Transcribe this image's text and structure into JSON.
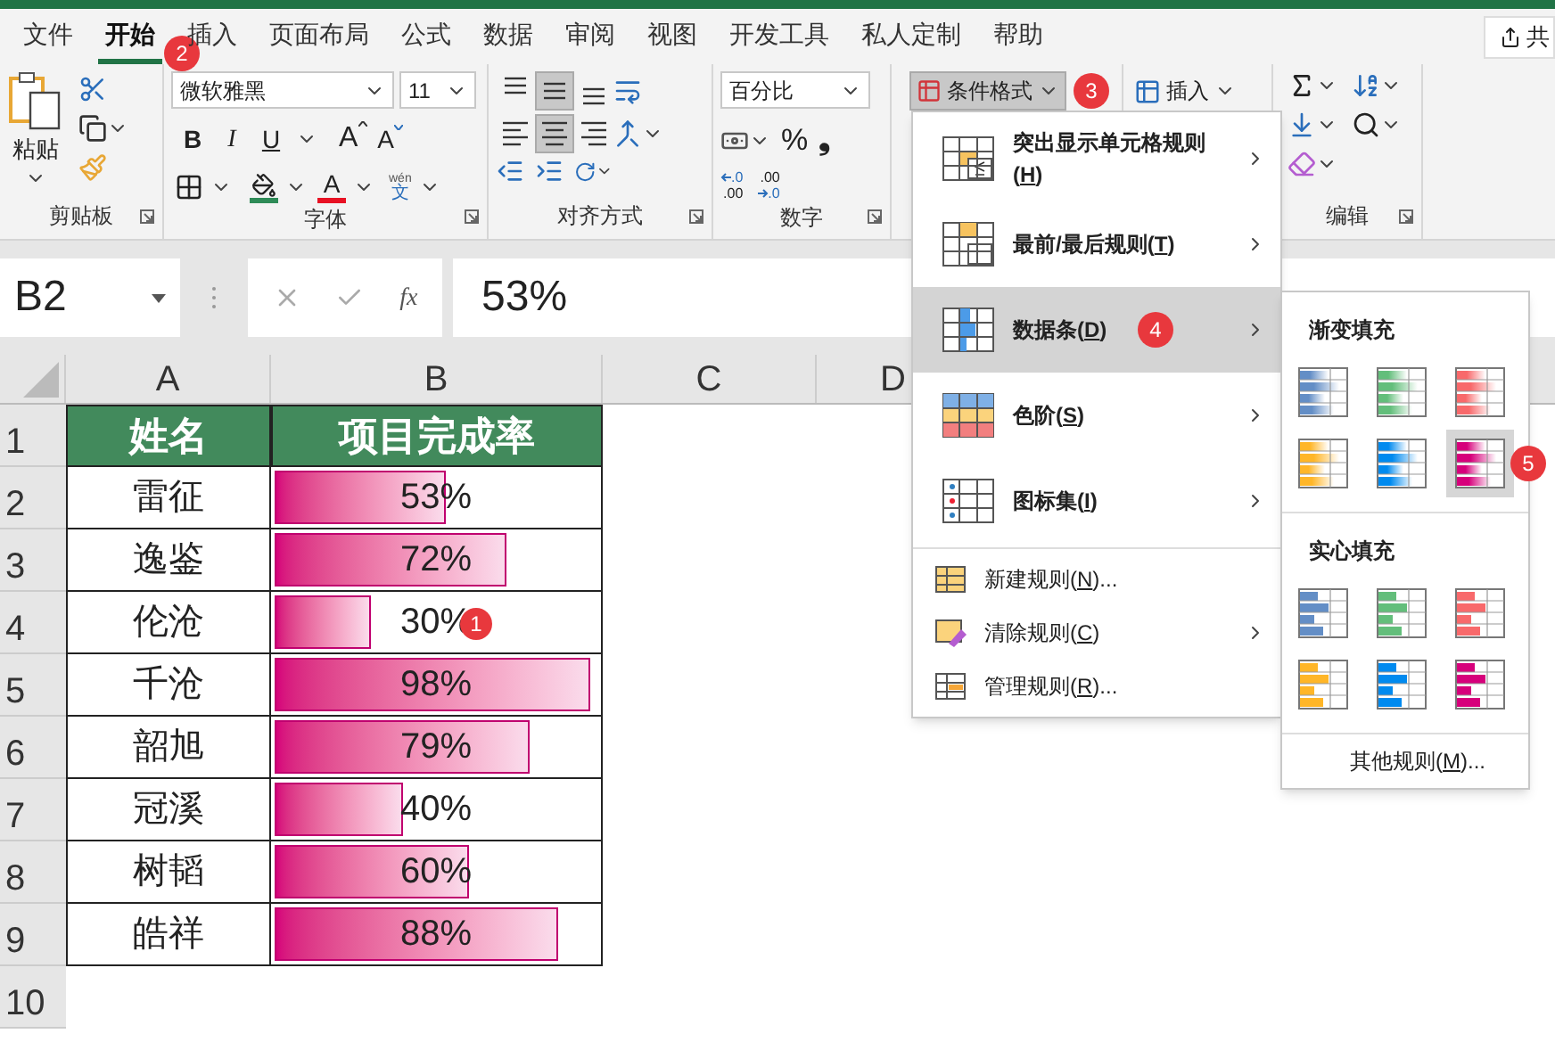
{
  "tabs": [
    {
      "label": "文件",
      "selected": false
    },
    {
      "label": "开始",
      "selected": true,
      "badge": "2"
    },
    {
      "label": "插入",
      "selected": false
    },
    {
      "label": "页面布局",
      "selected": false
    },
    {
      "label": "公式",
      "selected": false
    },
    {
      "label": "数据",
      "selected": false
    },
    {
      "label": "审阅",
      "selected": false
    },
    {
      "label": "视图",
      "selected": false
    },
    {
      "label": "开发工具",
      "selected": false
    },
    {
      "label": "私人定制",
      "selected": false
    },
    {
      "label": "帮助",
      "selected": false
    }
  ],
  "share_button": "共",
  "ribbon": {
    "clipboard": {
      "paste": "粘贴",
      "label": "剪贴板"
    },
    "font": {
      "name": "微软雅黑",
      "size": "11",
      "bold": "B",
      "italic": "I",
      "underline": "U",
      "grow": "A",
      "shrink": "A",
      "font_color": "A",
      "phonetic_top": "wén",
      "phonetic_bottom": "文",
      "label": "字体"
    },
    "alignment": {
      "buttons": [
        {
          "kind": "top",
          "selected": false
        },
        {
          "kind": "middle",
          "selected": true
        },
        {
          "kind": "bottom",
          "selected": false
        },
        {
          "kind": "left",
          "selected": false
        },
        {
          "kind": "center",
          "selected": true
        },
        {
          "kind": "right",
          "selected": false
        }
      ],
      "label": "对齐方式"
    },
    "number": {
      "format": "百分比",
      "percent": "%",
      "comma": "❟",
      "increase_decimal": [
        ".0",
        ".00"
      ],
      "decrease_decimal": [
        ".00",
        ".0"
      ],
      "label": "数字"
    },
    "styles": {
      "conditional_format": "条件格式",
      "badge": "3"
    },
    "cells": {
      "insert": "插入"
    },
    "editing": {
      "label": "编辑"
    }
  },
  "formula_bar": {
    "name_box": "B2",
    "fx": "fx",
    "formula": "53%"
  },
  "sheet": {
    "columns": [
      "A",
      "B",
      "C",
      "D"
    ],
    "row_numbers": [
      "1",
      "2",
      "3",
      "4",
      "5",
      "6",
      "7",
      "8",
      "9",
      "10"
    ],
    "header": [
      "姓名",
      "项目完成率"
    ],
    "rows": [
      {
        "name": "雷征",
        "value": "53%",
        "level": 0.53
      },
      {
        "name": "逸鉴",
        "value": "72%",
        "level": 0.72
      },
      {
        "name": "伦沧",
        "value": "30%",
        "level": 0.3,
        "badge": "1"
      },
      {
        "name": "千沧",
        "value": "98%",
        "level": 0.98
      },
      {
        "name": "韶旭",
        "value": "79%",
        "level": 0.79
      },
      {
        "name": "冠溪",
        "value": "40%",
        "level": 0.4
      },
      {
        "name": "树韬",
        "value": "60%",
        "level": 0.6
      },
      {
        "name": "皓祥",
        "value": "88%",
        "level": 0.88
      }
    ]
  },
  "menu": {
    "items": [
      {
        "kind": "highlight",
        "label": "突出显示单元格规则(",
        "key": "H",
        "tail": ")",
        "submenu": true,
        "selected": false
      },
      {
        "kind": "topbottom",
        "label": "最前/最后规则(",
        "key": "T",
        "tail": ")",
        "submenu": true,
        "selected": false
      },
      {
        "kind": "databar",
        "label": "数据条(",
        "key": "D",
        "tail": ")",
        "submenu": true,
        "selected": true,
        "badge": "4"
      },
      {
        "kind": "colorscale",
        "label": "色阶(",
        "key": "S",
        "tail": ")",
        "submenu": true,
        "selected": false
      },
      {
        "kind": "iconset",
        "label": "图标集(",
        "key": "I",
        "tail": ")",
        "submenu": true,
        "selected": false
      },
      {
        "kind": "new",
        "label": "新建规则(",
        "key": "N",
        "tail": ")...",
        "submenu": false,
        "selected": false
      },
      {
        "kind": "clear",
        "label": "清除规则(",
        "key": "C",
        "tail": ")",
        "submenu": true,
        "selected": false
      },
      {
        "kind": "manage",
        "label": "管理规则(",
        "key": "R",
        "tail": ")...",
        "submenu": false,
        "selected": false
      }
    ]
  },
  "submenu": {
    "sections": [
      {
        "title": "渐变填充",
        "kind": "gradient",
        "swatches": [
          {
            "color": "#638ec6",
            "selected": false
          },
          {
            "color": "#63be7b",
            "selected": false
          },
          {
            "color": "#f8696b",
            "selected": false
          },
          {
            "color": "#ffb628",
            "selected": false
          },
          {
            "color": "#008aef",
            "selected": false
          },
          {
            "color": "#d6007b",
            "selected": true,
            "badge": "5"
          }
        ]
      },
      {
        "title": "实心填充",
        "kind": "solid",
        "swatches": [
          {
            "color": "#638ec6",
            "selected": false
          },
          {
            "color": "#63be7b",
            "selected": false
          },
          {
            "color": "#f8696b",
            "selected": false
          },
          {
            "color": "#ffb628",
            "selected": false
          },
          {
            "color": "#008aef",
            "selected": false
          },
          {
            "color": "#d6007b",
            "selected": false
          }
        ]
      }
    ],
    "more": {
      "label": "其他规则(",
      "key": "M",
      "tail": ")..."
    }
  }
}
